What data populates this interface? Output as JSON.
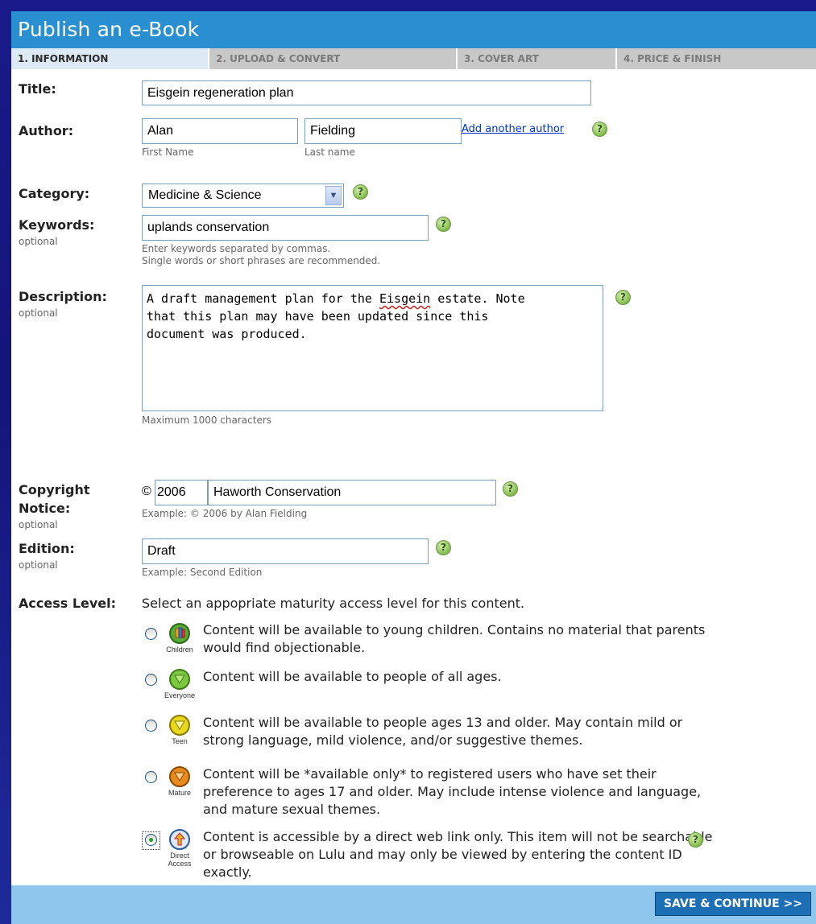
{
  "page_title": "Publish an e-Book",
  "tabs": [
    {
      "label": "1. INFORMATION"
    },
    {
      "label": "2. UPLOAD & CONVERT"
    },
    {
      "label": "3. COVER ART"
    },
    {
      "label": "4. PRICE & FINISH"
    }
  ],
  "form": {
    "title": {
      "label": "Title:",
      "value": "Eisgein regeneration plan"
    },
    "author": {
      "label": "Author:",
      "first_value": "Alan",
      "first_hint": "First Name",
      "last_value": "Fielding",
      "last_hint": "Last name",
      "add_link": "Add another author"
    },
    "category": {
      "label": "Category:",
      "selected": "Medicine & Science"
    },
    "keywords": {
      "label": "Keywords:",
      "sub": "optional",
      "value": "uplands conservation",
      "hint1": "Enter keywords separated by commas.",
      "hint2": "Single words or short phrases are recommended."
    },
    "description": {
      "label": "Description:",
      "sub": "optional",
      "line1_a": "A draft management plan for the ",
      "line1_word": "Eisgein",
      "line1_b": " estate. Note",
      "line2": "that this plan may have been updated since this",
      "line3": "document was produced.",
      "hint": "Maximum 1000 characters"
    },
    "copyright": {
      "label1": "Copyright",
      "label2": "Notice:",
      "sub": "optional",
      "symbol": "©",
      "year": "2006",
      "holder": "Haworth Conservation",
      "hint": "Example: © 2006 by Alan Fielding"
    },
    "edition": {
      "label": "Edition:",
      "sub": "optional",
      "value": "Draft",
      "hint": "Example: Second Edition"
    },
    "access": {
      "label": "Access Level:",
      "intro": "Select an appopriate maturity access level for this content.",
      "options": [
        {
          "caption": "Children",
          "text": "Content will be available to young children. Contains no material that parents would find objectionable.",
          "checked": false,
          "icon": "children-rating-icon",
          "color": "#5aa83a"
        },
        {
          "caption": "Everyone",
          "text": "Content will be available to people of all ages.",
          "checked": false,
          "icon": "everyone-rating-icon",
          "color": "#7cc83e"
        },
        {
          "caption": "Teen",
          "text": "Content will be available to people ages 13 and older. May contain mild or strong language, mild violence, and/or suggestive themes.",
          "checked": false,
          "icon": "teen-rating-icon",
          "color": "#e8d81e"
        },
        {
          "caption": "Mature",
          "text": "Content will be *available only* to registered users who have set their preference to ages 17 and older. May include intense violence and language, and mature sexual themes.",
          "checked": false,
          "icon": "mature-rating-icon",
          "color": "#e88a1e"
        },
        {
          "caption1": "Direct",
          "caption2": "Access",
          "text": "Content is accessible by a direct web link only. This item will not be searchable or browseable on Lulu and may only be viewed by entering the content ID exactly.",
          "checked": true,
          "icon": "direct-access-rating-icon",
          "color": "#3a78c8"
        }
      ]
    }
  },
  "help_glyph": "?",
  "select_arrow": "▼",
  "save_button": "SAVE & CONTINUE >>"
}
